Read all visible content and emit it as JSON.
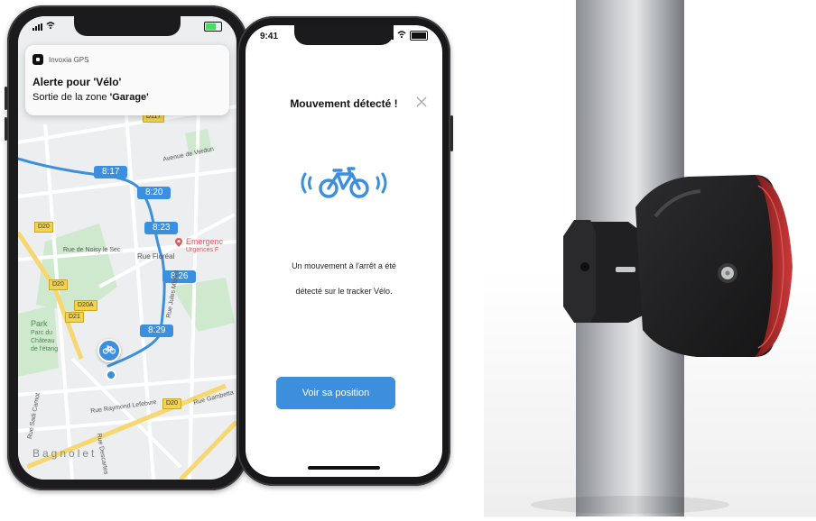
{
  "phone_map": {
    "status_icons": [
      "signal-icon",
      "wifi-icon",
      "battery-icon"
    ],
    "notification": {
      "app_name": "Invoxia GPS",
      "title": "Alerte pour 'Vélo'",
      "body_prefix": "Sortie de la zone ",
      "zone": "'Garage'"
    },
    "route_times": [
      "8:17",
      "8:20",
      "8:23",
      "8:26",
      "8:29"
    ],
    "road_tags": [
      "D117",
      "D20",
      "D20",
      "D20A",
      "D21",
      "D20"
    ],
    "street_labels": [
      "Avenue de Verdun",
      "Rue de Noisy le Sec",
      "Rue Floréal",
      "Rue Jules Michel",
      "Rue Raymond Lefebvre",
      "Rue Gambetta",
      "Rue Sadi Carnot",
      "Rue Descartes"
    ],
    "place_labels": {
      "park_name": "Park",
      "park_detail": [
        "Parc du",
        "Château",
        "de l'étang"
      ],
      "town": "Bagnolet"
    },
    "poi": {
      "name": "Emergenc",
      "detail": "Urgences F"
    }
  },
  "phone_alert": {
    "time": "9:41",
    "title": "Mouvement détecté !",
    "message_line1": "Un mouvement à l'arrêt a été",
    "message_line2": "détecté sur le tracker Vélo.",
    "button": "Voir sa position"
  },
  "colors": {
    "accent": "#3b8fdc",
    "route": "#3b8fdc",
    "road_tag": "#f4d24a"
  }
}
